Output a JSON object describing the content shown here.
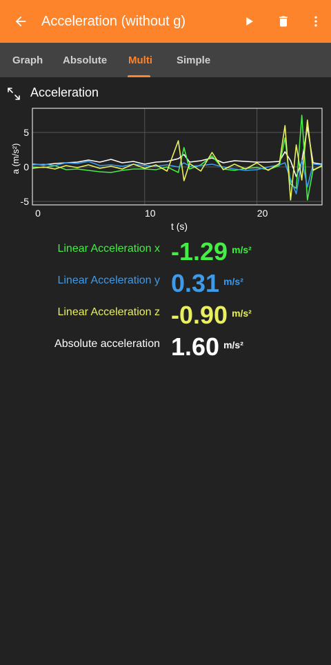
{
  "appbar": {
    "title": "Acceleration (without g)",
    "background": "#fd842a",
    "icons": [
      "arrow-left-icon",
      "play-icon",
      "trash-icon",
      "more-vert-icon"
    ]
  },
  "tabs": [
    {
      "label": "Graph",
      "active": false
    },
    {
      "label": "Absolute",
      "active": false
    },
    {
      "label": "Multi",
      "active": true
    },
    {
      "label": "Simple",
      "active": false
    }
  ],
  "chart_header": {
    "title": "Acceleration",
    "icon": "expand-icon"
  },
  "chart_data": {
    "type": "line",
    "title": "",
    "xlabel": "t (s)",
    "ylabel": "a (m/s²)",
    "xlim": [
      0,
      25.8
    ],
    "ylim": [
      -5.5,
      8.5
    ],
    "xticks": [
      0,
      10,
      20
    ],
    "yticks": [
      5,
      0,
      -5
    ],
    "grid": true,
    "series": [
      {
        "color": "#ffffff",
        "x": [
          0,
          1,
          2,
          3,
          4,
          5,
          6,
          7,
          8,
          9,
          10,
          11,
          12,
          13,
          13.5,
          14,
          15,
          16,
          17,
          18,
          19,
          20,
          21,
          22,
          22.5,
          23,
          23.5,
          24,
          24.5,
          25,
          25.8
        ],
        "y": [
          0.4,
          0.3,
          0.5,
          0.6,
          0.7,
          1.0,
          0.7,
          1.1,
          0.6,
          0.8,
          0.4,
          0.7,
          0.8,
          1.2,
          1.8,
          0.7,
          0.9,
          1.3,
          0.6,
          0.9,
          0.8,
          0.7,
          0.7,
          0.8,
          2.2,
          0.9,
          -1.4,
          0.8,
          5.8,
          0.6,
          0.4
        ]
      },
      {
        "color": "#44ee44",
        "x": [
          0,
          1,
          2,
          3,
          4,
          5,
          6,
          7,
          8,
          9,
          10,
          11,
          12,
          13,
          13.5,
          14,
          15,
          16,
          17,
          18,
          19,
          20,
          21,
          22,
          22.5,
          23,
          23.5,
          24,
          24.5,
          25,
          25.8
        ],
        "y": [
          0.0,
          -0.1,
          0.2,
          -0.4,
          -0.3,
          -0.5,
          -0.7,
          -0.8,
          -0.5,
          -0.3,
          -0.3,
          -0.4,
          0.0,
          -0.8,
          2.8,
          -0.3,
          0.3,
          1.6,
          -0.3,
          -0.5,
          -0.2,
          -0.1,
          -0.4,
          0.2,
          4.2,
          -2.5,
          -3.1,
          7.5,
          -4.8,
          -0.4,
          0.1
        ]
      },
      {
        "color": "#3e9bea",
        "x": [
          0,
          1,
          2,
          3,
          4,
          5,
          6,
          7,
          8,
          9,
          10,
          11,
          12,
          13,
          13.5,
          14,
          15,
          16,
          17,
          18,
          19,
          20,
          21,
          22,
          22.5,
          23,
          23.5,
          24,
          24.5,
          25,
          25.8
        ],
        "y": [
          0.3,
          0.4,
          0.2,
          0.6,
          0.5,
          0.8,
          0.2,
          0.3,
          0.1,
          0.4,
          0.2,
          0.1,
          0.3,
          0.0,
          0.6,
          0.1,
          0.2,
          0.4,
          0.0,
          -0.3,
          -0.5,
          -0.4,
          0.0,
          0.3,
          0.6,
          -1.8,
          -3.9,
          1.0,
          -2.9,
          0.4,
          0.3
        ]
      },
      {
        "color": "#e8f060",
        "x": [
          0,
          1,
          2,
          3,
          4,
          5,
          6,
          7,
          8,
          9,
          10,
          11,
          12,
          13,
          13.5,
          14,
          15,
          16,
          17,
          18,
          19,
          20,
          21,
          22,
          22.5,
          23,
          23.5,
          24,
          24.5,
          25,
          25.8
        ],
        "y": [
          -0.2,
          0.0,
          -0.3,
          0.2,
          -0.1,
          0.3,
          -0.2,
          0.1,
          -0.3,
          0.4,
          -0.2,
          0.3,
          -0.6,
          3.8,
          -2.0,
          0.5,
          -0.6,
          2.1,
          -0.4,
          0.4,
          -0.3,
          0.6,
          -0.5,
          0.5,
          6.0,
          -4.8,
          3.2,
          -1.9,
          6.8,
          -0.5,
          0.2
        ]
      }
    ]
  },
  "readouts": [
    {
      "label": "Linear Acceleration x",
      "value": "-1.29",
      "unit": "m/s²",
      "color": "#44ee44"
    },
    {
      "label": "Linear Acceleration y",
      "value": "0.31",
      "unit": "m/s²",
      "color": "#3e9bea"
    },
    {
      "label": "Linear Acceleration z",
      "value": "-0.90",
      "unit": "m/s²",
      "color": "#e8f060"
    },
    {
      "label": "Absolute acceleration",
      "value": "1.60",
      "unit": "m/s²",
      "color": "#ffffff"
    }
  ]
}
